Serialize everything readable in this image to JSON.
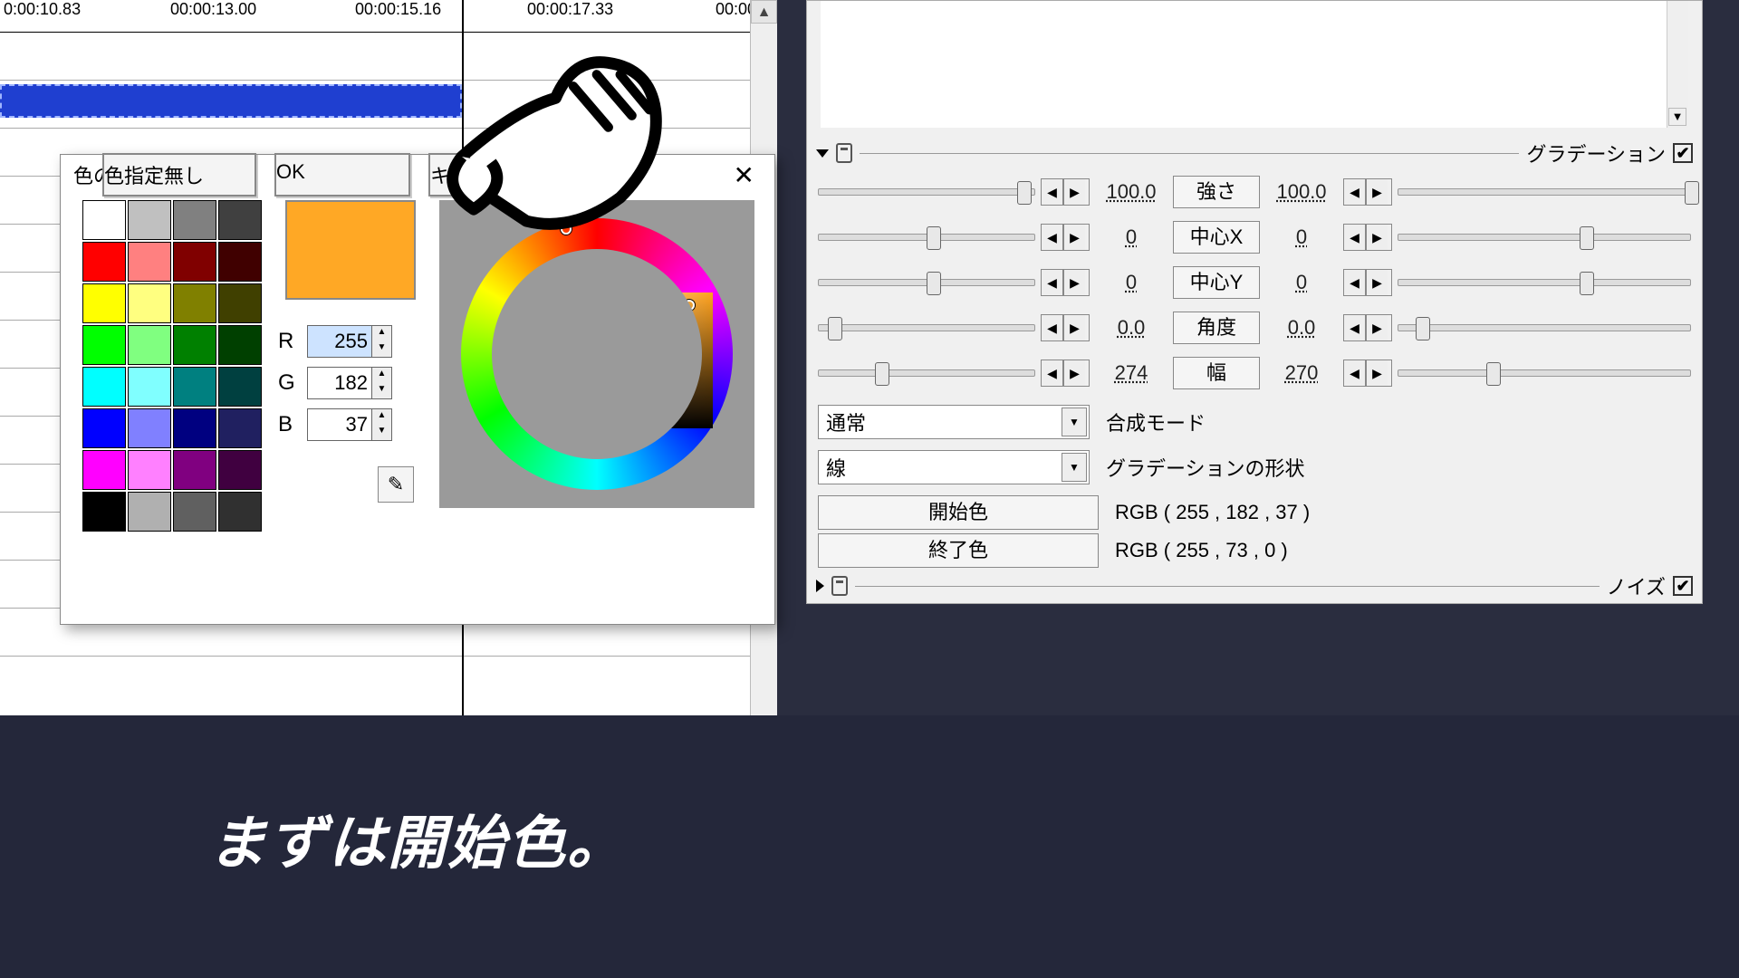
{
  "timeline": {
    "ticks": [
      "0:00:10.83",
      "00:00:13.00",
      "00:00:15.16",
      "00:00:17.33",
      "00:00:"
    ]
  },
  "dialog": {
    "title": "色の選択",
    "r_label": "R",
    "g_label": "G",
    "b_label": "B",
    "r": "255",
    "g": "182",
    "b": "37",
    "no_color": "色指定無し",
    "ok": "OK",
    "cancel": "キャンセル",
    "swatch_colors": [
      "#ffffff",
      "#c0c0c0",
      "#808080",
      "#404040",
      "#ff0000",
      "#ff8080",
      "#800000",
      "#400000",
      "#ffff00",
      "#ffff80",
      "#808000",
      "#404000",
      "#00ff00",
      "#80ff80",
      "#008000",
      "#004000",
      "#00ffff",
      "#80ffff",
      "#008080",
      "#004040",
      "#0000ff",
      "#8080ff",
      "#000080",
      "#202060",
      "#ff00ff",
      "#ff80ff",
      "#800080",
      "#400040",
      "#000000",
      "#b0b0b0",
      "#606060",
      "#303030"
    ],
    "preview_color": "#ffa825"
  },
  "panel": {
    "section_label": "グラデーション",
    "noise_label": "ノイズ",
    "blend_label": "合成モード",
    "blend_value": "通常",
    "shape_label": "グラデーションの形状",
    "shape_value": "線",
    "start_color_btn": "開始色",
    "start_color_val": "RGB ( 255 , 182 , 37 )",
    "end_color_btn": "終了色",
    "end_color_val": "RGB ( 255 , 73 , 0 )",
    "params": [
      {
        "name": "強さ",
        "l": "100.0",
        "r": "100.0",
        "lp": 92,
        "rp": 98
      },
      {
        "name": "中心X",
        "l": "0",
        "r": "0",
        "lp": 50,
        "rp": 62
      },
      {
        "name": "中心Y",
        "l": "0",
        "r": "0",
        "lp": 50,
        "rp": 62
      },
      {
        "name": "角度",
        "l": "0.0",
        "r": "0.0",
        "lp": 4,
        "rp": 6
      },
      {
        "name": "幅",
        "l": "274",
        "r": "270",
        "lp": 26,
        "rp": 30
      }
    ]
  },
  "caption": "まずは開始色。"
}
